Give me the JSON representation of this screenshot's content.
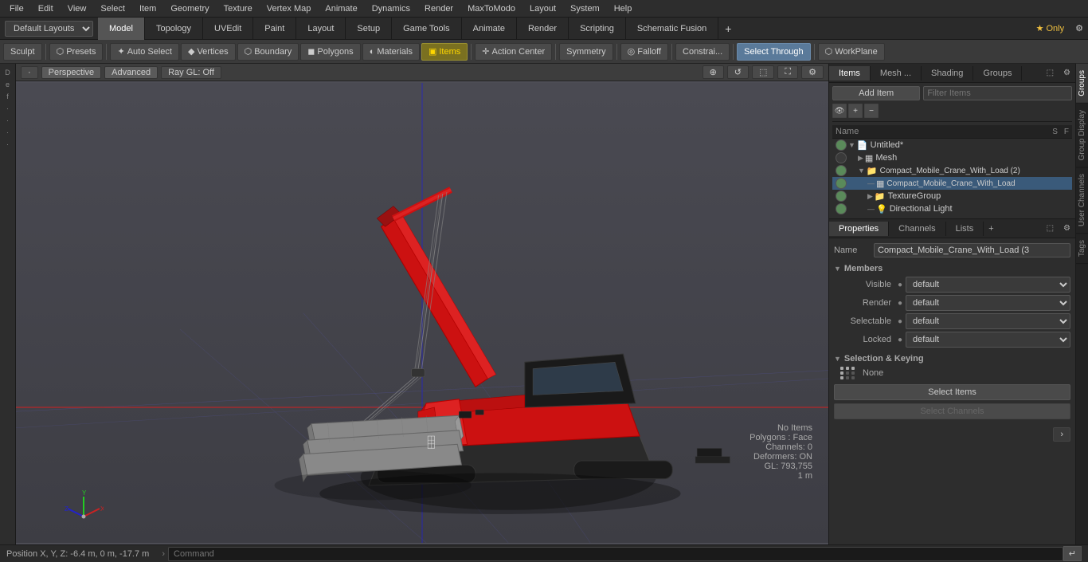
{
  "menubar": {
    "items": [
      "File",
      "Edit",
      "View",
      "Select",
      "Item",
      "Geometry",
      "Texture",
      "Vertex Map",
      "Animate",
      "Dynamics",
      "Render",
      "MaxToModo",
      "Layout",
      "System",
      "Help"
    ]
  },
  "layout": {
    "selector_label": "Default Layouts",
    "tabs": [
      "Model",
      "Topology",
      "UVEdit",
      "Paint",
      "Layout",
      "Setup",
      "Game Tools",
      "Animate",
      "Render",
      "Scripting",
      "Schematic Fusion"
    ],
    "active_tab": "Model",
    "star_only": "★ Only"
  },
  "toolbar": {
    "sculpt": "Sculpt",
    "presets": "Presets",
    "auto_select": "Auto Select",
    "vertices": "Vertices",
    "boundary": "Boundary",
    "polygons": "Polygons",
    "materials": "Materials",
    "items": "Items",
    "action_center": "Action Center",
    "symmetry": "Symmetry",
    "falloff": "Falloff",
    "constraints": "Constrai...",
    "select_through": "Select Through",
    "workplane": "WorkPlane"
  },
  "viewport": {
    "mode": "Perspective",
    "shading": "Advanced",
    "raygl": "Ray GL: Off",
    "info_no_items": "No Items",
    "info_polygons": "Polygons : Face",
    "info_channels": "Channels: 0",
    "info_deformers": "Deformers: ON",
    "info_gl": "GL: 793,755",
    "info_scale": "1 m",
    "position": "Position X, Y, Z:  -6.4 m, 0 m, -17.7 m"
  },
  "items_panel": {
    "tabs": [
      "Items",
      "Mesh ...",
      "Shading",
      "Groups"
    ],
    "active_tab": "Items",
    "add_item_btn": "Add Item",
    "filter_placeholder": "Filter Items",
    "col_header_name": "Name",
    "tree": [
      {
        "id": "untitled",
        "label": "Untitled*",
        "icon": "📄",
        "indent": 0,
        "type": "root",
        "expanded": true,
        "eye": true
      },
      {
        "id": "mesh",
        "label": "Mesh",
        "icon": "▦",
        "indent": 1,
        "type": "mesh",
        "expanded": false,
        "eye": false
      },
      {
        "id": "crane_group",
        "label": "Compact_Mobile_Crane_With_Load (2)",
        "icon": "📁",
        "indent": 1,
        "type": "group",
        "expanded": true,
        "eye": true
      },
      {
        "id": "crane_mesh",
        "label": "Compact_Mobile_Crane_With_Load",
        "icon": "▦",
        "indent": 2,
        "type": "mesh",
        "expanded": false,
        "eye": true
      },
      {
        "id": "texture_group",
        "label": "TextureGroup",
        "icon": "📁",
        "indent": 2,
        "type": "group",
        "expanded": false,
        "eye": true
      },
      {
        "id": "dir_light",
        "label": "Directional Light",
        "icon": "💡",
        "indent": 2,
        "type": "light",
        "expanded": false,
        "eye": true
      }
    ]
  },
  "properties": {
    "tabs": [
      "Properties",
      "Channels",
      "Lists"
    ],
    "active_tab": "Properties",
    "name_label": "Name",
    "name_value": "Compact_Mobile_Crane_With_Load (3",
    "members_section": "Members",
    "visible_label": "Visible",
    "visible_value": "default",
    "render_label": "Render",
    "render_value": "default",
    "selectable_label": "Selectable",
    "selectable_value": "default",
    "locked_label": "Locked",
    "locked_value": "default",
    "selection_keying_section": "Selection & Keying",
    "keying_label": "None",
    "select_items_btn": "Select Items",
    "select_channels_btn": "Select Channels"
  },
  "far_right_tabs": [
    "Groups",
    "Group Display",
    "User Channels",
    "Tags"
  ],
  "command_bar": {
    "label": "Command",
    "placeholder": "Command"
  },
  "icons": {
    "eye": "👁",
    "expand": "▶",
    "collapse": "▼",
    "lock": "🔒",
    "render": "●",
    "star": "★"
  }
}
